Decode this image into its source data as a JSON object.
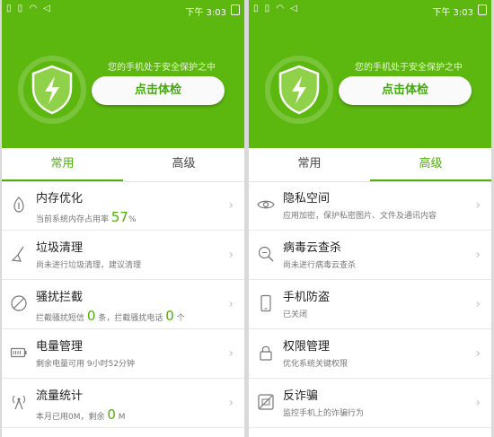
{
  "status_bar": {
    "time": "下午 3:03"
  },
  "colors": {
    "brand": "#5cb80f",
    "accent": "#4fae0a"
  },
  "panels": [
    {
      "tip": "您的手机处于安全保护之中",
      "check_label": "点击体检",
      "tabs": [
        "常用",
        "高级"
      ],
      "active_tab": "常用",
      "items": [
        {
          "icon": "memory-icon",
          "title": "内存优化",
          "sub_a": "当前系统内存占用率",
          "num_a": "57",
          "sub_b": "%",
          "num_b": "",
          "sub_c": ""
        },
        {
          "icon": "broom-icon",
          "title": "垃圾清理",
          "sub_a": "尚未进行垃圾清理，建议清理",
          "num_a": "",
          "sub_b": "",
          "num_b": "",
          "sub_c": ""
        },
        {
          "icon": "block-icon",
          "title": "骚扰拦截",
          "sub_a": "拦截骚扰短信",
          "num_a": "0",
          "sub_b": "条，拦截骚扰电话",
          "num_b": "0",
          "sub_c": "个"
        },
        {
          "icon": "battery-icon",
          "title": "电量管理",
          "sub_a": "剩余电量可用   9小时52分钟",
          "num_a": "",
          "sub_b": "",
          "num_b": "",
          "sub_c": ""
        },
        {
          "icon": "antenna-icon",
          "title": "流量统计",
          "sub_a": "本月已用0M，剩余",
          "num_a": "0",
          "sub_b": "M",
          "num_b": "",
          "sub_c": ""
        }
      ]
    },
    {
      "tip": "您的手机处于安全保护之中",
      "check_label": "点击体检",
      "tabs": [
        "常用",
        "高级"
      ],
      "active_tab": "高级",
      "items": [
        {
          "icon": "eye-icon",
          "title": "隐私空间",
          "sub_a": "应用加密，保护私密图片、文件及通讯内容"
        },
        {
          "icon": "virus-scan-icon",
          "title": "病毒云查杀",
          "sub_a": "尚未进行病毒云查杀"
        },
        {
          "icon": "phone-icon",
          "title": "手机防盗",
          "sub_a": "已关闭"
        },
        {
          "icon": "lock-icon",
          "title": "权限管理",
          "sub_a": "优化系统关键权限"
        },
        {
          "icon": "anti-fraud-icon",
          "title": "反诈骗",
          "sub_a": "监控手机上的诈骗行为"
        }
      ]
    }
  ]
}
